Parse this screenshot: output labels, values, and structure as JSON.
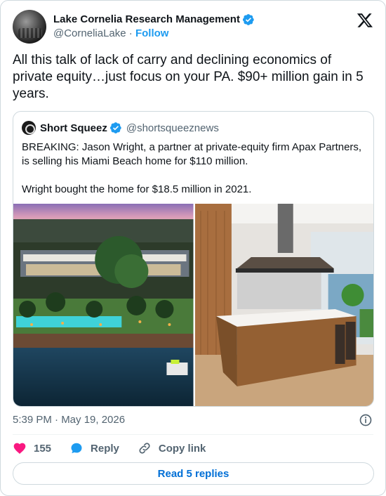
{
  "author": {
    "name": "Lake Cornelia Research Management",
    "handle": "@CorneliaLake",
    "separator": "·",
    "follow_label": "Follow"
  },
  "tweet": {
    "text": "All this talk of lack of carry and declining economics of private equity…just focus on your PA.  $90+ million gain in 5 years."
  },
  "quoted": {
    "name": "Short Squeez",
    "handle": "@shortsqueeznews",
    "text": "BREAKING: Jason Wright, a partner at private-equity firm Apax Partners, is selling his Miami Beach home for $110 million.\n\nWright bought the home for $18.5 million in 2021."
  },
  "meta": {
    "timestamp": "5:39 PM · May 19, 2026"
  },
  "actions": {
    "like_count": "155",
    "reply_label": "Reply",
    "copy_link_label": "Copy link"
  },
  "replies_button": "Read 5 replies",
  "colors": {
    "accent": "#1d9bf0",
    "like": "#f91880",
    "link": "#006fd6",
    "muted": "#536471",
    "border": "#cfd9de"
  },
  "icons": [
    "verified-badge-icon",
    "x-logo-icon",
    "info-icon",
    "heart-icon",
    "reply-bubble-icon",
    "link-icon"
  ]
}
